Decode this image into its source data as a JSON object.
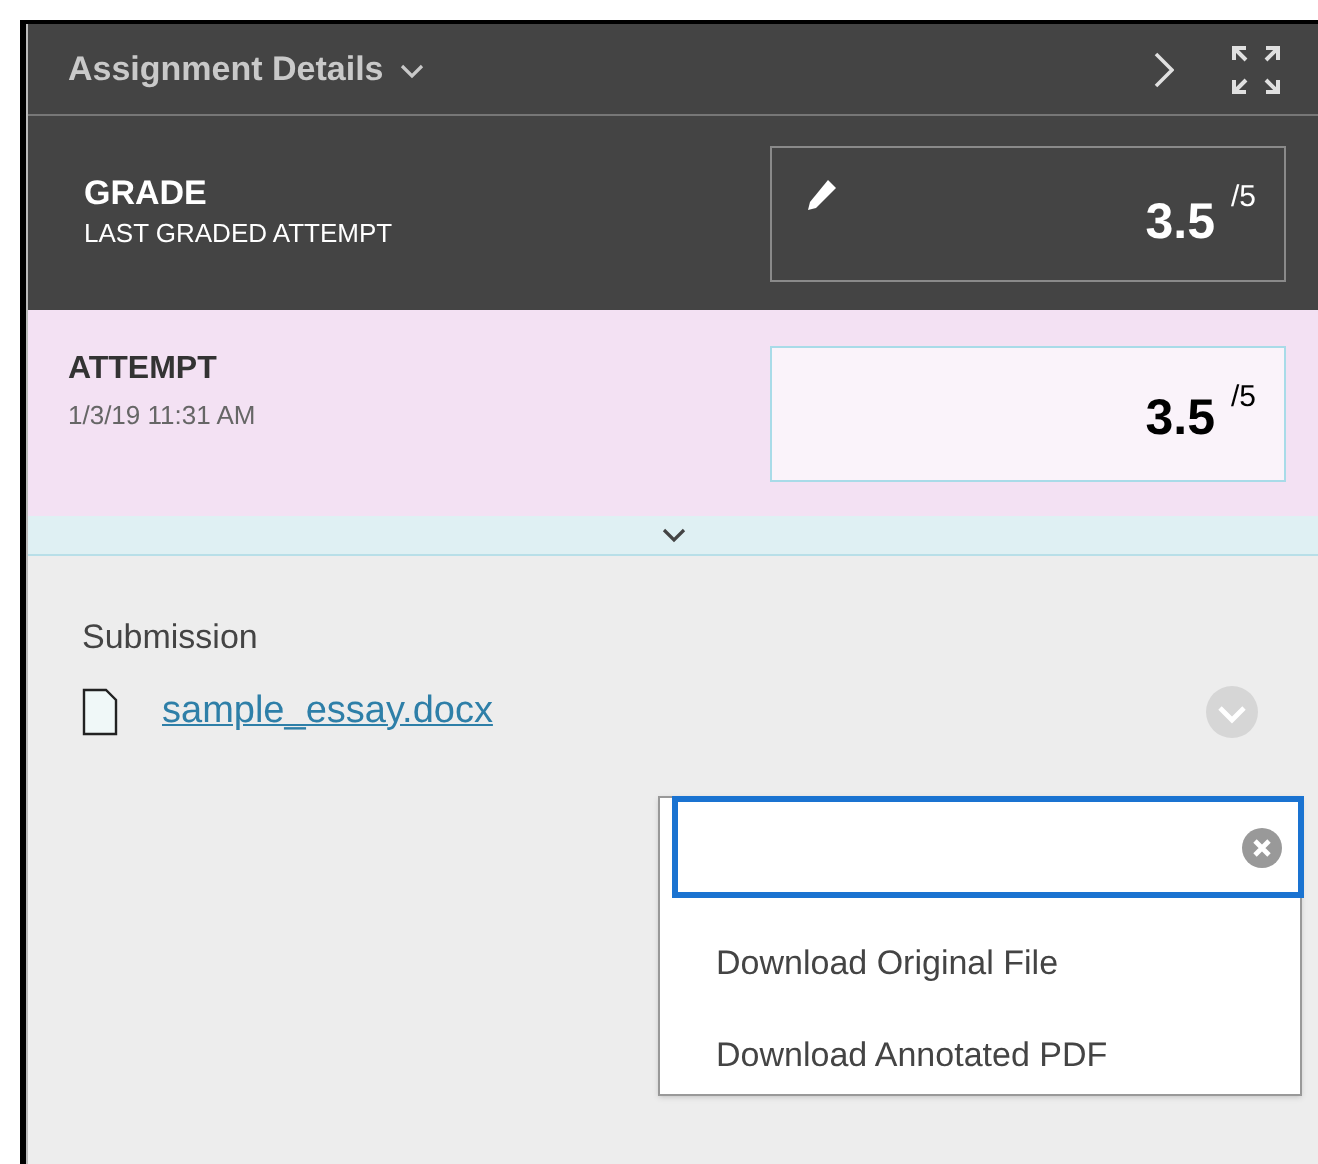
{
  "header": {
    "title": "Assignment Details"
  },
  "grade": {
    "label": "GRADE",
    "sublabel": "LAST GRADED ATTEMPT",
    "score": "3.5",
    "out_of": "/5"
  },
  "attempt": {
    "label": "ATTEMPT",
    "date": "1/3/19 11:31 AM",
    "score": "3.5",
    "out_of": "/5"
  },
  "submission": {
    "label": "Submission",
    "file": "sample_essay.docx"
  },
  "file_menu": {
    "items": [
      {
        "label": "Download Original File"
      },
      {
        "label": "Download Annotated PDF"
      }
    ]
  }
}
